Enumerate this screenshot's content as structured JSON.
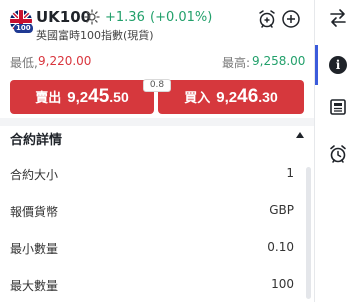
{
  "header": {
    "symbol": "UK100",
    "flag_badge": "100",
    "change": "+1.36",
    "change_pct": "(+0.01%)",
    "subtitle": "英國富時100指數(現貨)",
    "icons": [
      "sun-icon",
      "alarm-add-icon",
      "add-icon"
    ]
  },
  "range": {
    "low_label": "最低,",
    "low_value": "9,220.00",
    "high_label": "最高:",
    "high_value": "9,258.00"
  },
  "trade": {
    "sell_label": "賣出",
    "sell_price_a": "9,2",
    "sell_price_b": "45",
    "sell_price_c": ".50",
    "buy_label": "買入",
    "buy_price_a": "9,2",
    "buy_price_b": "46",
    "buy_price_c": ".30",
    "spread": "0.8",
    "color": "#d6383d"
  },
  "details": {
    "title": "合約詳情",
    "rows": [
      {
        "label": "合約大小",
        "value": "1"
      },
      {
        "label": "報價貨幣",
        "value": "GBP"
      },
      {
        "label": "最小數量",
        "value": "0.10"
      },
      {
        "label": "最大數量",
        "value": "100"
      }
    ]
  },
  "sidebar": {
    "items": [
      "swap-icon",
      "info-icon",
      "news-icon",
      "alarm-icon"
    ],
    "active": "info-icon",
    "accent": "#3b5bdb"
  }
}
